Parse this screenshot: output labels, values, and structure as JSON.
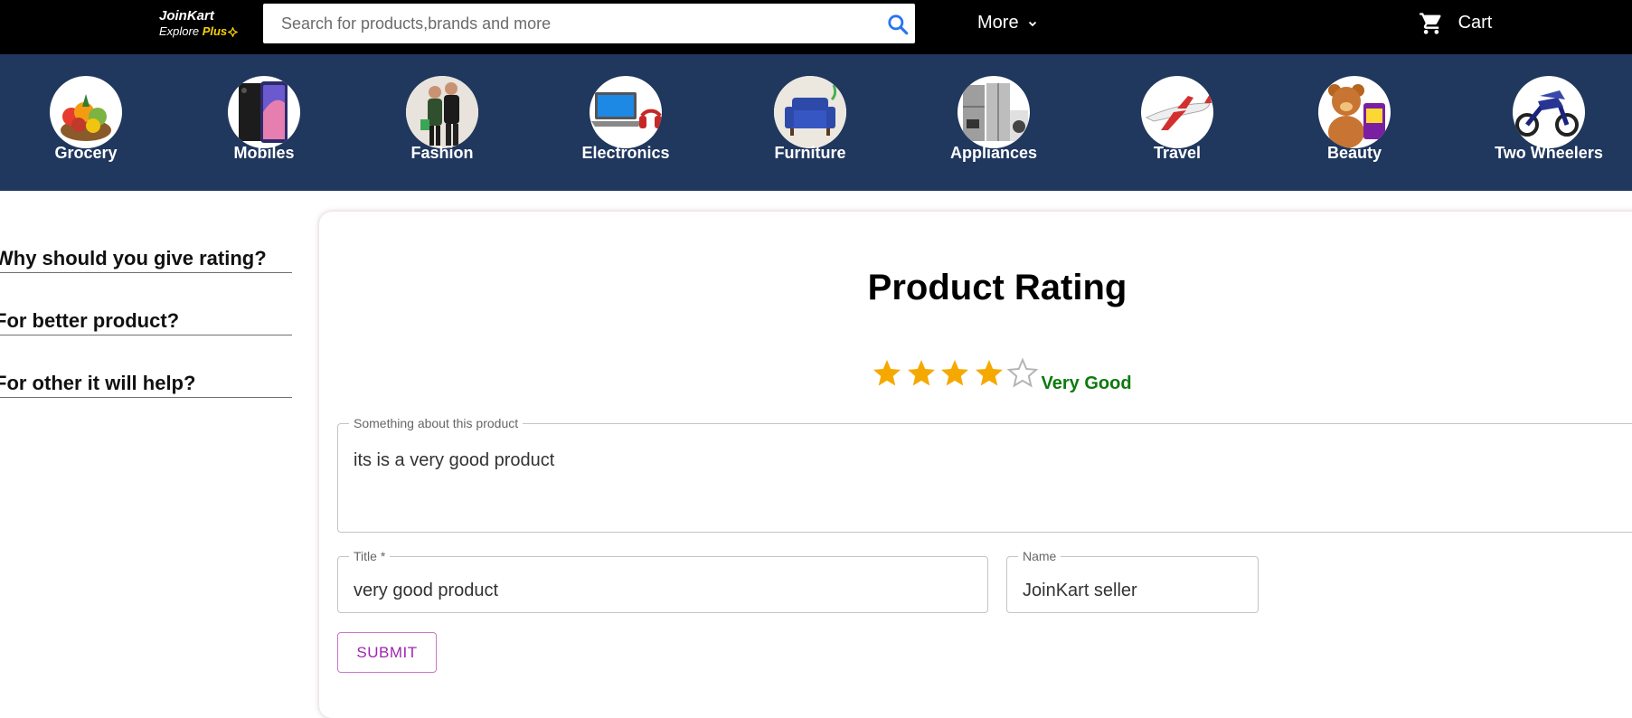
{
  "brand": {
    "name": "JoinKart",
    "tagline_prefix": "Explore",
    "tagline_highlight": "Plus"
  },
  "header": {
    "search_placeholder": "Search for products,brands and more",
    "more_label": "More",
    "cart_label": "Cart"
  },
  "categories": [
    {
      "label": "Grocery",
      "icon": "grocery-basket"
    },
    {
      "label": "Mobiles",
      "icon": "smartphones"
    },
    {
      "label": "Fashion",
      "icon": "fashion-couple"
    },
    {
      "label": "Electronics",
      "icon": "laptop-headphones"
    },
    {
      "label": "Furniture",
      "icon": "sofa-chair"
    },
    {
      "label": "Appliances",
      "icon": "home-appliances"
    },
    {
      "label": "Travel",
      "icon": "airplane"
    },
    {
      "label": "Beauty",
      "icon": "teddy-toys"
    },
    {
      "label": "Two Wheelers",
      "icon": "motorbikes"
    }
  ],
  "sidebar": {
    "questions": [
      "Why should you give rating?",
      "For better product?",
      "For other it will help?"
    ]
  },
  "rating_form": {
    "title": "Product Rating",
    "rating": {
      "value": 4,
      "max": 5,
      "label": "Very Good"
    },
    "colors": {
      "star_filled": "#f5a900",
      "star_empty": "#b3b3b3",
      "label": "#0e7a0d"
    },
    "review": {
      "label": "Something about this product",
      "value": "its is a very good product"
    },
    "title_field": {
      "label": "Title *",
      "value": "very good product"
    },
    "name_field": {
      "label": "Name",
      "value": "JoinKart seller"
    },
    "submit_label": "SUBMIT"
  },
  "colors": {
    "header_bg": "#000000",
    "category_bg": "#20375e",
    "accent": "#9c27b0",
    "search_icon": "#2874f0"
  }
}
